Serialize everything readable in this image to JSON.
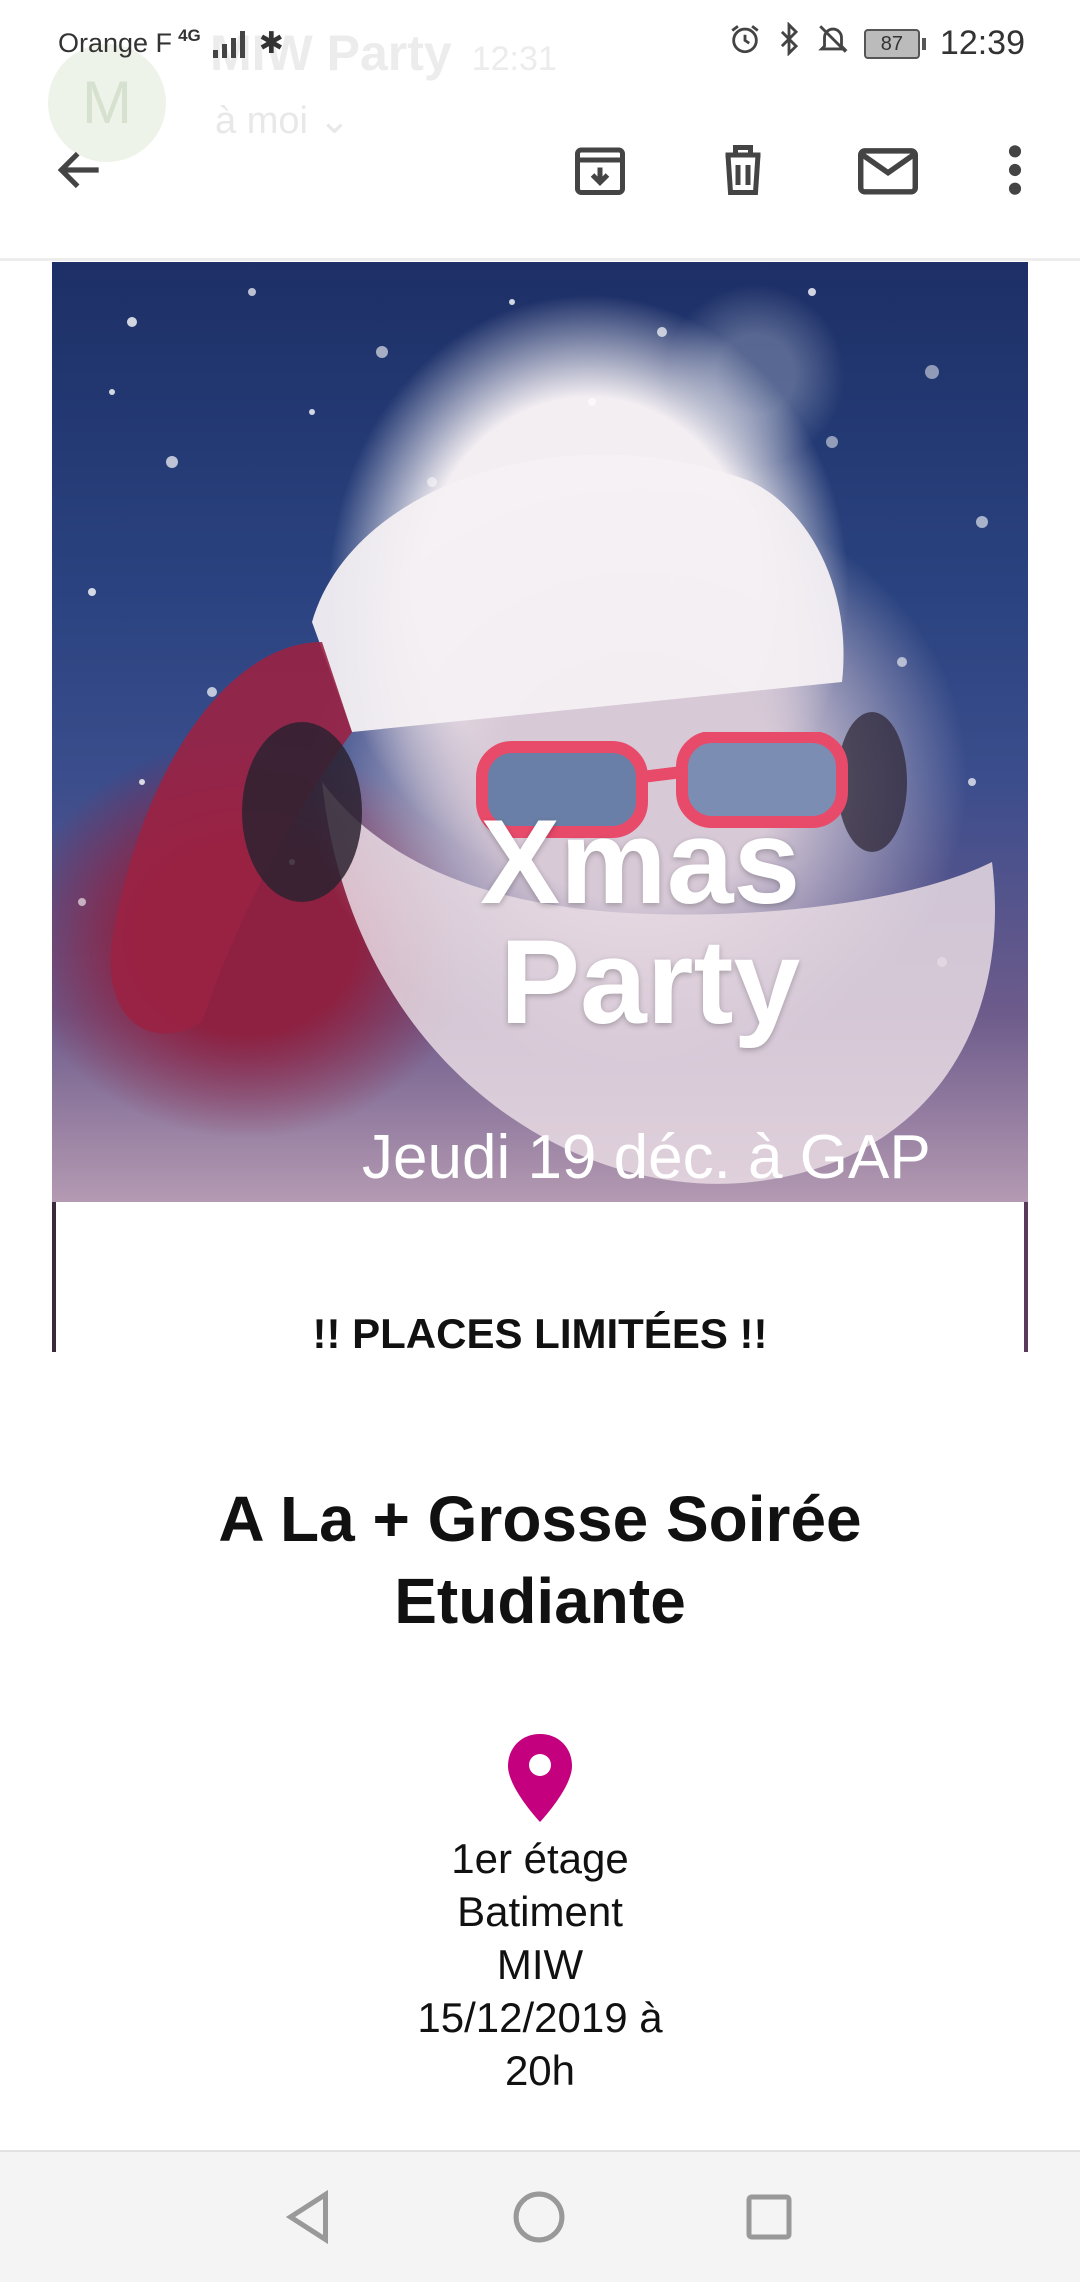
{
  "status_bar": {
    "carrier": "Orange F",
    "network": "4G",
    "battery": "87",
    "time": "12:39"
  },
  "ghost_header": {
    "avatar_letter": "M",
    "sender": "MIW Party",
    "sent_time": "12:31",
    "recipient": "à moi"
  },
  "toolbar": {
    "icons": [
      "back-arrow-icon",
      "archive-icon",
      "delete-icon",
      "mark-unread-icon",
      "more-icon"
    ]
  },
  "email": {
    "hero": {
      "title_line1": "Xmas",
      "title_line2": "Party",
      "date_line": "Jeudi 19 déc. à GAP"
    },
    "places": "!! PLACES LIMITÉES !!",
    "headline": "A La + Grosse Soirée Etudiante",
    "location": {
      "line1": "1er étage",
      "line2": "Batiment",
      "line3": "MIW",
      "line4": "15/12/2019 à",
      "line5": "20h"
    }
  },
  "colors": {
    "pin": "#c4007f",
    "icon": "#444444"
  }
}
